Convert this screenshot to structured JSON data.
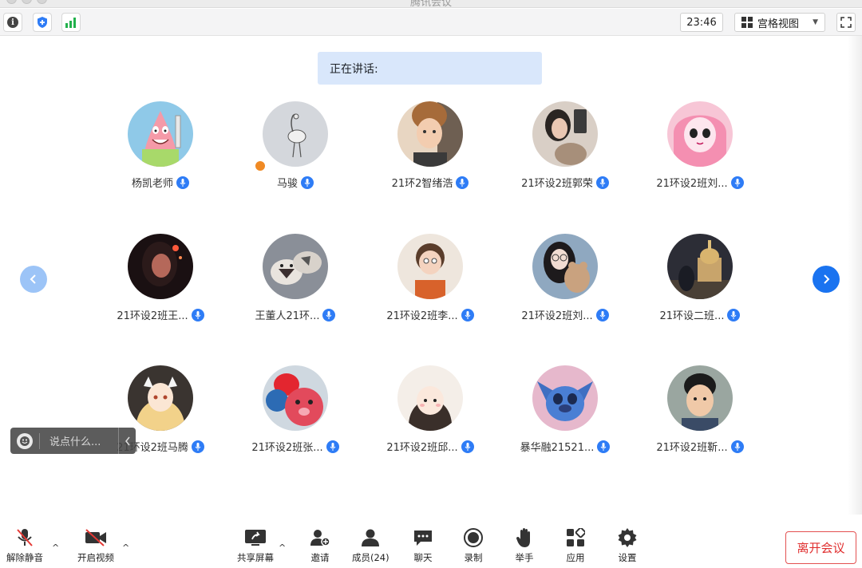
{
  "window": {
    "title": "腾讯会议"
  },
  "topbar": {
    "timer": "23:46",
    "view_mode": "宫格视图",
    "icons": [
      "info-icon",
      "shield-icon",
      "signal-icon",
      "grid-icon",
      "fullscreen-icon"
    ]
  },
  "speaking": {
    "label": "正在讲话:"
  },
  "participants": [
    {
      "name": "杨凯老师",
      "avatar": "patrick-star"
    },
    {
      "name": "马骏",
      "avatar": "flamingo-sketch",
      "host": true
    },
    {
      "name": "21环2智绪浩",
      "avatar": "child-photo"
    },
    {
      "name": "21环设2班郭荣",
      "avatar": "girl-with-cat"
    },
    {
      "name": "21环设2班刘...",
      "avatar": "pink-anime-girl"
    },
    {
      "name": "21环设2班王...",
      "avatar": "girl-dark-photo"
    },
    {
      "name": "王董人21环...",
      "avatar": "husky-dogs"
    },
    {
      "name": "21环设2班李...",
      "avatar": "baby-photo"
    },
    {
      "name": "21环设2班刘...",
      "avatar": "girl-with-teddy"
    },
    {
      "name": "21环设二班...",
      "avatar": "cathedral-night"
    },
    {
      "name": "21环设2班马腾",
      "avatar": "anime-fox-girl"
    },
    {
      "name": "21环设2班张...",
      "avatar": "elmo-lotso"
    },
    {
      "name": "21环设2班邱...",
      "avatar": "cartoon-girl"
    },
    {
      "name": "暴华融21521...",
      "avatar": "stitch"
    },
    {
      "name": "21环设2班靳...",
      "avatar": "boy-photo"
    }
  ],
  "chat": {
    "placeholder": "说点什么..."
  },
  "toolbar": {
    "unmute": "解除静音",
    "start_video": "开启视频",
    "share_screen": "共享屏幕",
    "invite": "邀请",
    "members": "成员(24)",
    "chat": "聊天",
    "record": "录制",
    "raise_hand": "举手",
    "apps": "应用",
    "settings": "设置",
    "leave": "离开会议"
  },
  "colors": {
    "accent": "#1a73f0",
    "leave": "#e02e2e",
    "speaking_bg": "#d9e7fb",
    "mic_badge": "#2e7cf6"
  }
}
